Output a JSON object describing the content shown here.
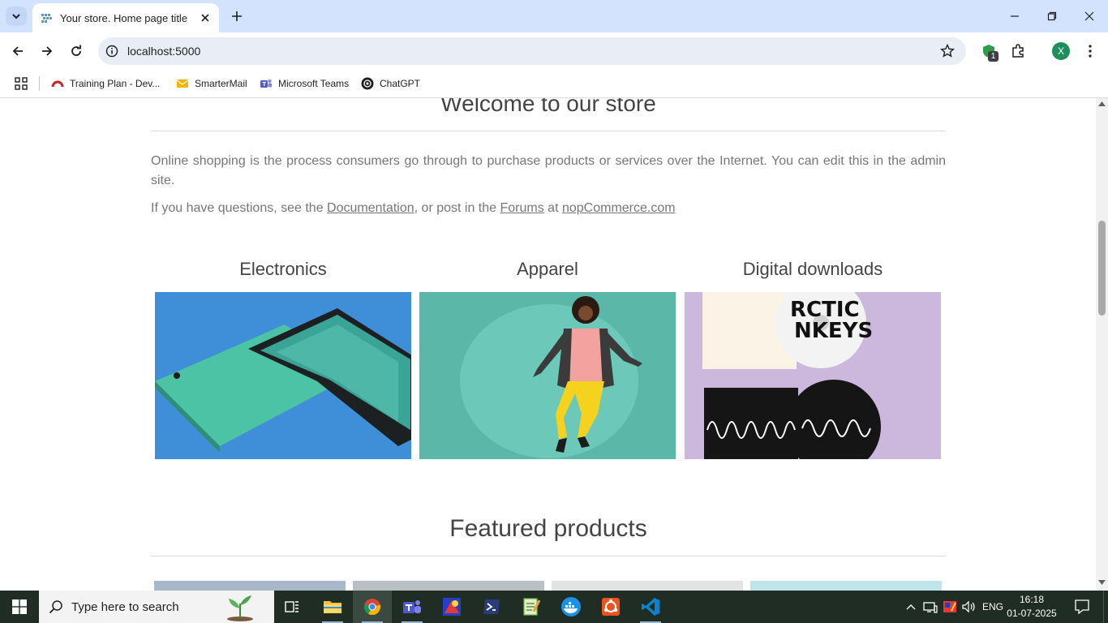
{
  "browser": {
    "tab_title": "Your store. Home page title",
    "url": "localhost:5000",
    "extension_badge": "1",
    "profile_initial": "X"
  },
  "bookmarks": [
    {
      "label": "Training Plan - Dev...",
      "icon": "training-plan-icon"
    },
    {
      "label": "SmarterMail",
      "icon": "mail-icon"
    },
    {
      "label": "Microsoft Teams",
      "icon": "teams-icon"
    },
    {
      "label": "ChatGPT",
      "icon": "chatgpt-icon"
    }
  ],
  "page": {
    "welcome_title": "Welcome to our store",
    "intro": "Online shopping is the process consumers go through to purchase products or services over the Internet. You can edit this in the admin site.",
    "help_prefix": "If you have questions, see the ",
    "help_link_docs": "Documentation",
    "help_mid": ", or post in the ",
    "help_link_forums": "Forums",
    "help_at": " at ",
    "help_link_site": "nopCommerce.com",
    "categories": [
      {
        "title": "Electronics"
      },
      {
        "title": "Apparel"
      },
      {
        "title": "Digital downloads"
      }
    ],
    "featured_title": "Featured products"
  },
  "taskbar": {
    "search_placeholder": "Type here to search",
    "language": "ENG",
    "time": "16:18",
    "date": "01-07-2025"
  },
  "colors": {
    "tabstrip": "#d3e3fd",
    "taskbar": "#1f2d24",
    "electronics_bg": "#3f8fd8",
    "apparel_bg": "#5bb8a8",
    "digital_bg": "#cbb8dc"
  }
}
